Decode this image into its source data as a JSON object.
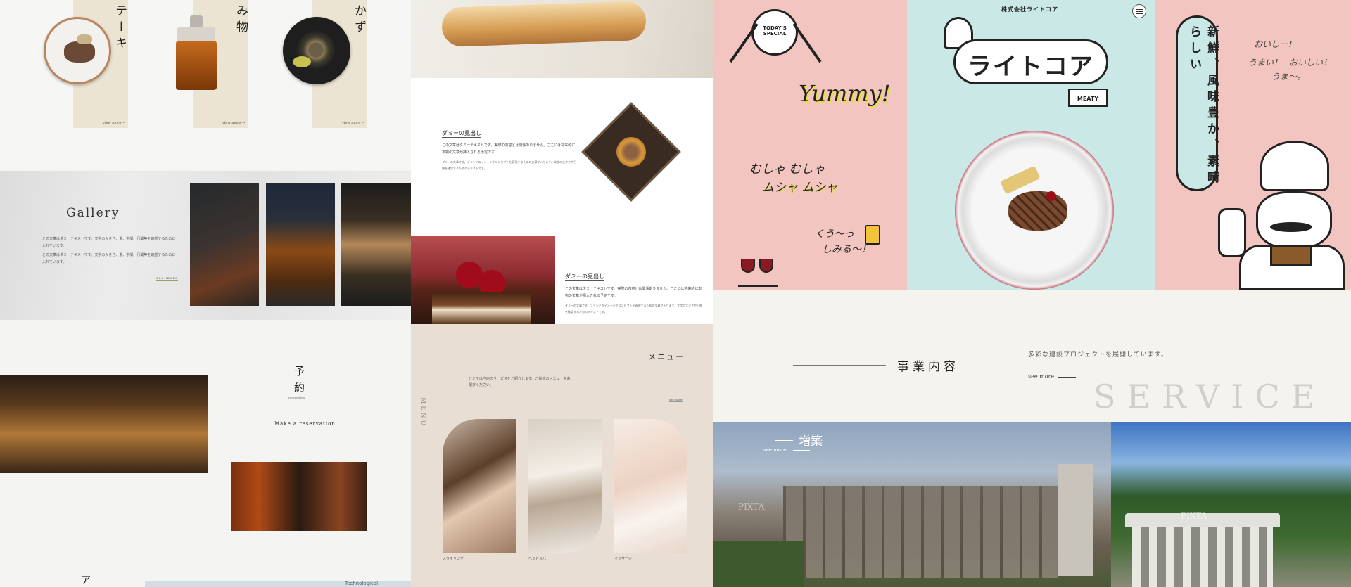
{
  "col1": {
    "products": [
      {
        "title": "テーキ",
        "more": "view more →"
      },
      {
        "title": "み物",
        "more": "view more →"
      },
      {
        "title": "かず",
        "more": "view more →"
      }
    ],
    "gallery": {
      "title": "Gallery",
      "body1": "この文章はダミーテキストです。文字の大きさ、量、字間、行間等を確認するために入れています。",
      "body2": "この文章はダミーテキストです。文字の大きさ、量、字間、行間等を確認するために入れています。",
      "more": "see more"
    },
    "reservation": {
      "title_1": "予",
      "title_2": "約",
      "subtitle": "reservation",
      "link": "Make a reservation"
    },
    "footer_char": "ア",
    "map_label": "Technological"
  },
  "col2": {
    "heading1": "ダミーの見出し",
    "heading2": "ダミーの見出し",
    "lead": "この文章はダミーテキストです。実際の内容とは関係ありません。ここには将来的に本物の文章が挿入される予定です。",
    "body": "ダミーの文章です。ブランドのイメージやコンセプトを表現するための文章が入ります。文字の大きさや行間を確認するためのテキストです。",
    "menu": {
      "title": "メニュー",
      "side_label": "MENU",
      "lead": "ここでは当店のサービスをご紹介します。ご希望のメニューをお選びください。",
      "more": "see more",
      "items": [
        "スタイリング",
        "ヘッドスパ",
        "マッサージ"
      ]
    }
  },
  "col3": {
    "company": "株式会社ライトコア",
    "logo": "ライトコア",
    "tag": "MEATY",
    "badge_1": "TODAY'S",
    "badge_2": "SPECIAL",
    "yummy": "Yummy!",
    "munya": "むしゃ むしゃ",
    "munya2": "ムシャ ムシャ",
    "kuu": "くう〜っ",
    "shimiru": "しみる〜！",
    "catch": "新鮮、風味豊か、素晴らしい",
    "voices": [
      "おいしー！",
      "うまい！",
      "おいしい！",
      "うま〜。"
    ],
    "service": {
      "title": "事業内容",
      "desc": "多彩な建設プロジェクトを展開しています。",
      "more": "see more",
      "big": "SERVICE",
      "sub_title": "増築",
      "sub_more": "see more",
      "watermark": "PIXTA"
    }
  },
  "colors": {
    "beige": "#ece4d2",
    "pink": "#f3c5c0",
    "mint": "#c9e8e6",
    "menu_bg": "#e8ded4"
  }
}
